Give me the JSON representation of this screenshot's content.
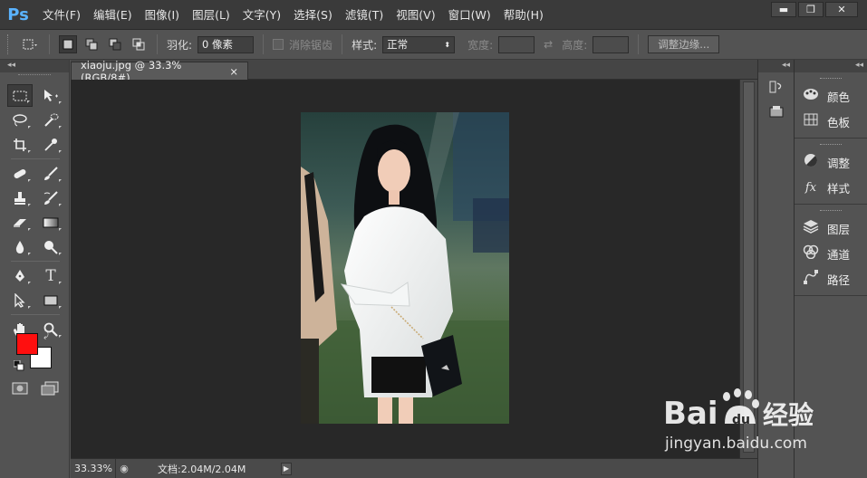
{
  "app": {
    "logo": "Ps"
  },
  "menu": {
    "items": [
      "文件(F)",
      "编辑(E)",
      "图像(I)",
      "图层(L)",
      "文字(Y)",
      "选择(S)",
      "滤镜(T)",
      "视图(V)",
      "窗口(W)",
      "帮助(H)"
    ]
  },
  "window_controls": {
    "minimize": "▬",
    "maximize": "❐",
    "close": "✕"
  },
  "options": {
    "feather_label": "羽化:",
    "feather_value": "0 像素",
    "antialias_label": "消除锯齿",
    "style_label": "样式:",
    "style_value": "正常",
    "width_label": "宽度:",
    "height_label": "高度:",
    "refine_edge": "调整边缘..."
  },
  "document": {
    "tab_title": "xiaoju.jpg @ 33.3%(RGB/8#)",
    "tab_close": "×"
  },
  "status": {
    "zoom": "33.33%",
    "doc_info": "文档:2.04M/2.04M",
    "arrow": "▶"
  },
  "colors": {
    "foreground": "#ff0f0f",
    "background": "#ffffff"
  },
  "panels": {
    "group1": [
      {
        "label": "颜色",
        "icon": "palette-icon"
      },
      {
        "label": "色板",
        "icon": "swatches-icon"
      }
    ],
    "group2": [
      {
        "label": "调整",
        "icon": "adjustments-icon"
      },
      {
        "label": "样式",
        "icon": "styles-icon"
      }
    ],
    "group3": [
      {
        "label": "图层",
        "icon": "layers-icon"
      },
      {
        "label": "通道",
        "icon": "channels-icon"
      },
      {
        "label": "路径",
        "icon": "paths-icon"
      }
    ]
  },
  "watermark": {
    "logo": "Bai du 经验",
    "url": "jingyan.baidu.com"
  }
}
